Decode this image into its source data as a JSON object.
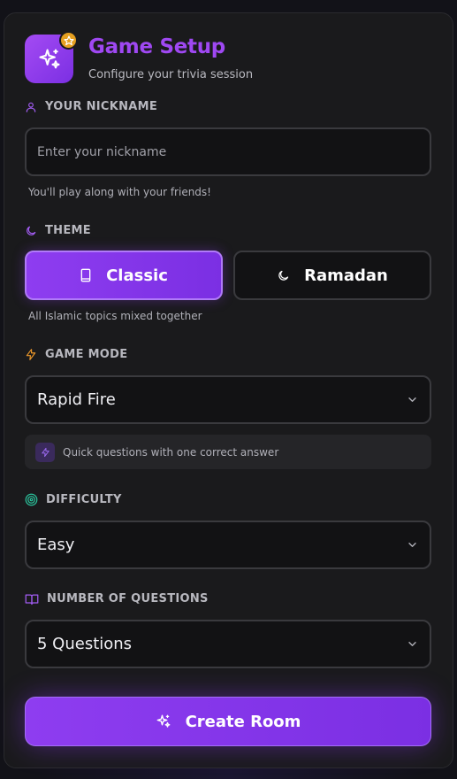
{
  "header": {
    "title": "Game Setup",
    "subtitle": "Configure your trivia session"
  },
  "nickname": {
    "label": "YOUR NICKNAME",
    "placeholder": "Enter your nickname",
    "value": "",
    "helper": "You'll play along with your friends!"
  },
  "theme": {
    "label": "THEME",
    "options": [
      {
        "label": "Classic",
        "icon": "book-icon",
        "selected": true
      },
      {
        "label": "Ramadan",
        "icon": "moon-icon",
        "selected": false
      }
    ],
    "helper": "All Islamic topics mixed together"
  },
  "game_mode": {
    "label": "GAME MODE",
    "value": "Rapid Fire",
    "hint": "Quick questions with one correct answer"
  },
  "difficulty": {
    "label": "DIFFICULTY",
    "value": "Easy"
  },
  "questions": {
    "label": "NUMBER OF QUESTIONS",
    "value": "5 Questions"
  },
  "create_button": {
    "label": "Create Room"
  },
  "colors": {
    "accent": "#9f48f2",
    "badge": "#e6a020",
    "mode_icon": "#e8952a",
    "difficulty_icon": "#2bbf9a"
  }
}
